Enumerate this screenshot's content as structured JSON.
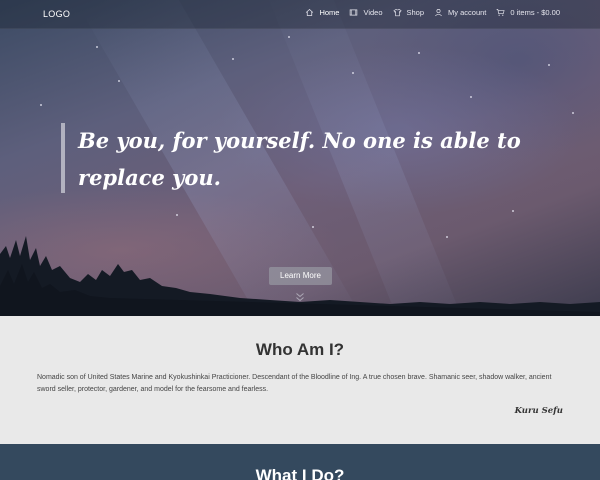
{
  "nav": {
    "logo": "LOGO",
    "items": [
      {
        "label": "Home",
        "icon": "home-icon"
      },
      {
        "label": "Video",
        "icon": "video-icon"
      },
      {
        "label": "Shop",
        "icon": "shirt-icon"
      },
      {
        "label": "My account",
        "icon": "user-icon"
      },
      {
        "label": "0 items - $0.00",
        "icon": "cart-icon"
      }
    ]
  },
  "hero": {
    "quote": "Be you, for yourself. No one is able to replace you.",
    "button_label": "Learn More"
  },
  "about": {
    "title": "Who Am I?",
    "text": "Nomadic son of United States Marine and Kyokushinkai Practicioner. Descendant of the Bloodline of Ing. A true chosen brave. Shamanic seer, shadow walker, ancient sword seller, protector, gardener, and model for the fearsome and fearless.",
    "signature": "Kuru Sefu"
  },
  "services": {
    "title": "What I Do?"
  },
  "colors": {
    "nav_overlay": "#141c28",
    "services_bg": "#34495e",
    "about_bg": "#e9e9e9",
    "button_bg": "#96969f"
  }
}
